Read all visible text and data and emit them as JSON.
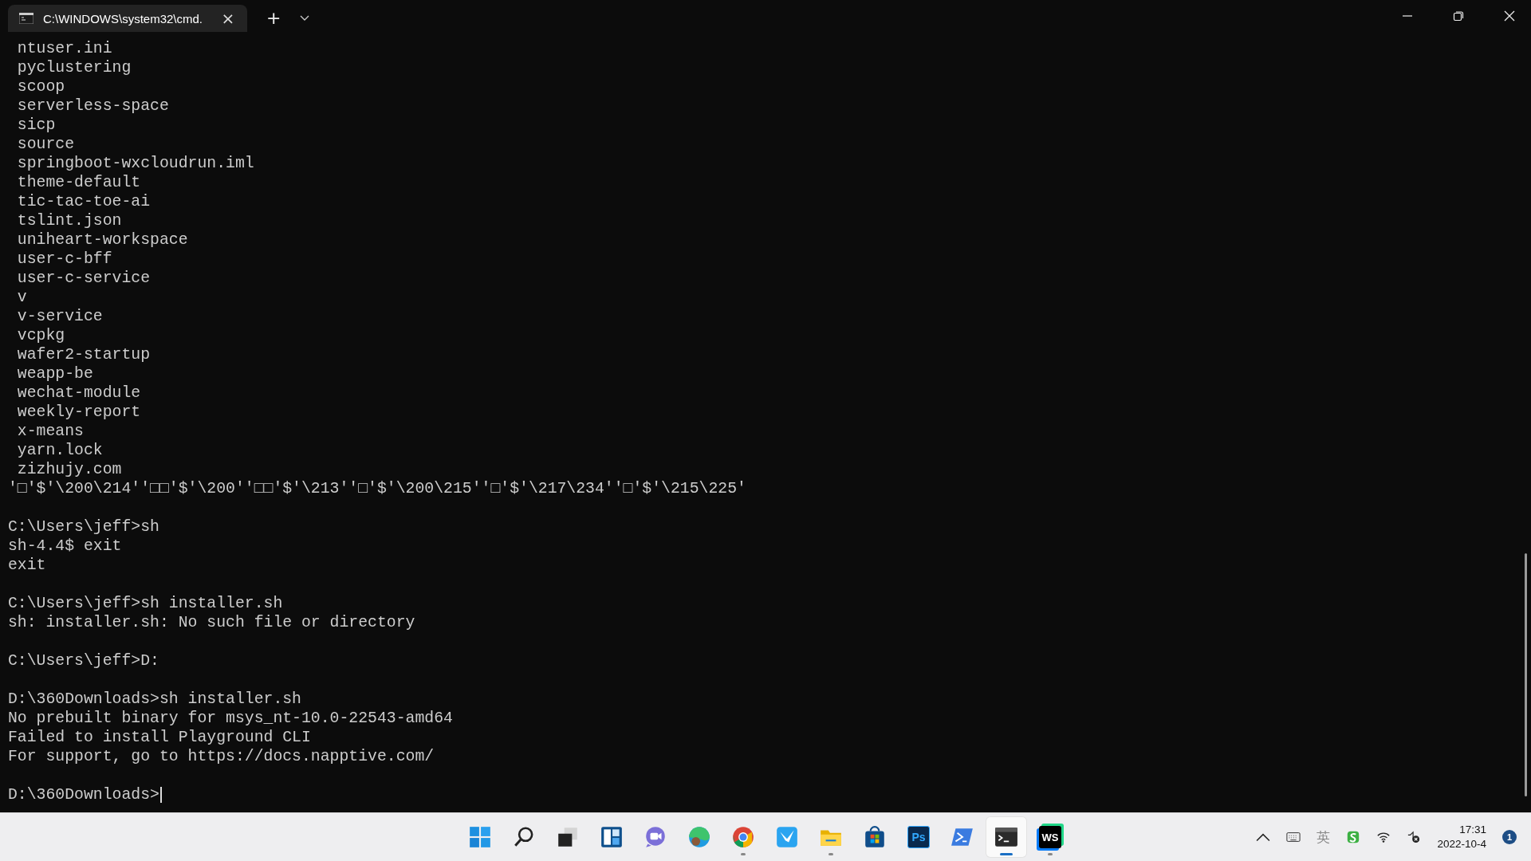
{
  "window": {
    "tab_title": "C:\\WINDOWS\\system32\\cmd.",
    "tab_close": "×",
    "new_tab": "+"
  },
  "terminal": {
    "blocks": [
      [
        " ntuser.ini",
        " pyclustering",
        " scoop",
        " serverless-space",
        " sicp",
        " source",
        " springboot-wxcloudrun.iml",
        " theme-default",
        " tic-tac-toe-ai",
        " tslint.json",
        " uniheart-workspace",
        " user-c-bff",
        " user-c-service",
        " v",
        " v-service",
        " vcpkg",
        " wafer2-startup",
        " weapp-be",
        " wechat-module",
        " weekly-report",
        " x-means",
        " yarn.lock",
        " zizhujy.com",
        "'□'$'\\200\\214''□□'$'\\200''□□'$'\\213''□'$'\\200\\215''□'$'\\217\\234''□'$'\\215\\225'"
      ],
      [
        "C:\\Users\\jeff>sh",
        "sh-4.4$ exit",
        "exit"
      ],
      [
        "C:\\Users\\jeff>sh installer.sh",
        "sh: installer.sh: No such file or directory"
      ],
      [
        "C:\\Users\\jeff>D:"
      ],
      [
        "D:\\360Downloads>sh installer.sh",
        "No prebuilt binary for msys_nt-10.0-22543-amd64",
        "Failed to install Playground CLI",
        "For support, go to https://docs.napptive.com/"
      ]
    ],
    "prompt": "D:\\360Downloads>",
    "cursor": true
  },
  "taskbar": {
    "apps": [
      {
        "kind": "start",
        "running": false,
        "active": false
      },
      {
        "kind": "search",
        "running": false,
        "active": false
      },
      {
        "kind": "taskview",
        "running": false,
        "active": false
      },
      {
        "kind": "widgets",
        "running": false,
        "active": false
      },
      {
        "kind": "chat",
        "running": false,
        "active": false
      },
      {
        "kind": "edge",
        "running": false,
        "active": false
      },
      {
        "kind": "chrome",
        "running": true,
        "active": false
      },
      {
        "kind": "bird",
        "running": false,
        "active": false
      },
      {
        "kind": "folder",
        "running": true,
        "active": false
      },
      {
        "kind": "store",
        "running": false,
        "active": false
      },
      {
        "kind": "ps",
        "label": "Ps",
        "running": false,
        "active": false
      },
      {
        "kind": "powershell",
        "running": false,
        "active": false
      },
      {
        "kind": "terminal",
        "running": true,
        "active": true
      },
      {
        "kind": "webstorm",
        "label": "WS",
        "running": true,
        "active": false
      }
    ],
    "ime": "英",
    "time": "17:31",
    "date": "2022-10-4",
    "notifications": "1"
  }
}
